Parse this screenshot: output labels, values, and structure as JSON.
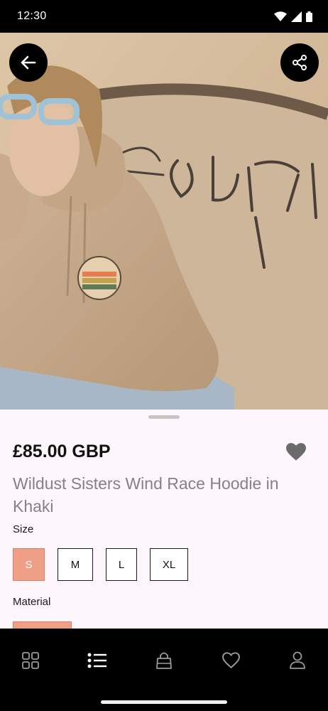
{
  "status_bar": {
    "time": "12:30"
  },
  "icons": {
    "back": "arrow-left-icon",
    "share": "share-icon",
    "favorite": "heart-icon",
    "nav": [
      "grid-icon",
      "list-icon",
      "bag-icon",
      "heart-outline-icon",
      "person-icon"
    ]
  },
  "gallery": {
    "image_count": 8,
    "current_index": 0
  },
  "product": {
    "price": "£85.00 GBP",
    "title": "Wildust Sisters Wind Race Hoodie in Khaki",
    "size_label": "Size",
    "sizes": [
      "S",
      "M",
      "L",
      "XL"
    ],
    "selected_size": "S",
    "material_label": "Material"
  },
  "colors": {
    "accent": "#ee9f86",
    "bar": "#000000",
    "sheet": "#fdf7fb"
  }
}
